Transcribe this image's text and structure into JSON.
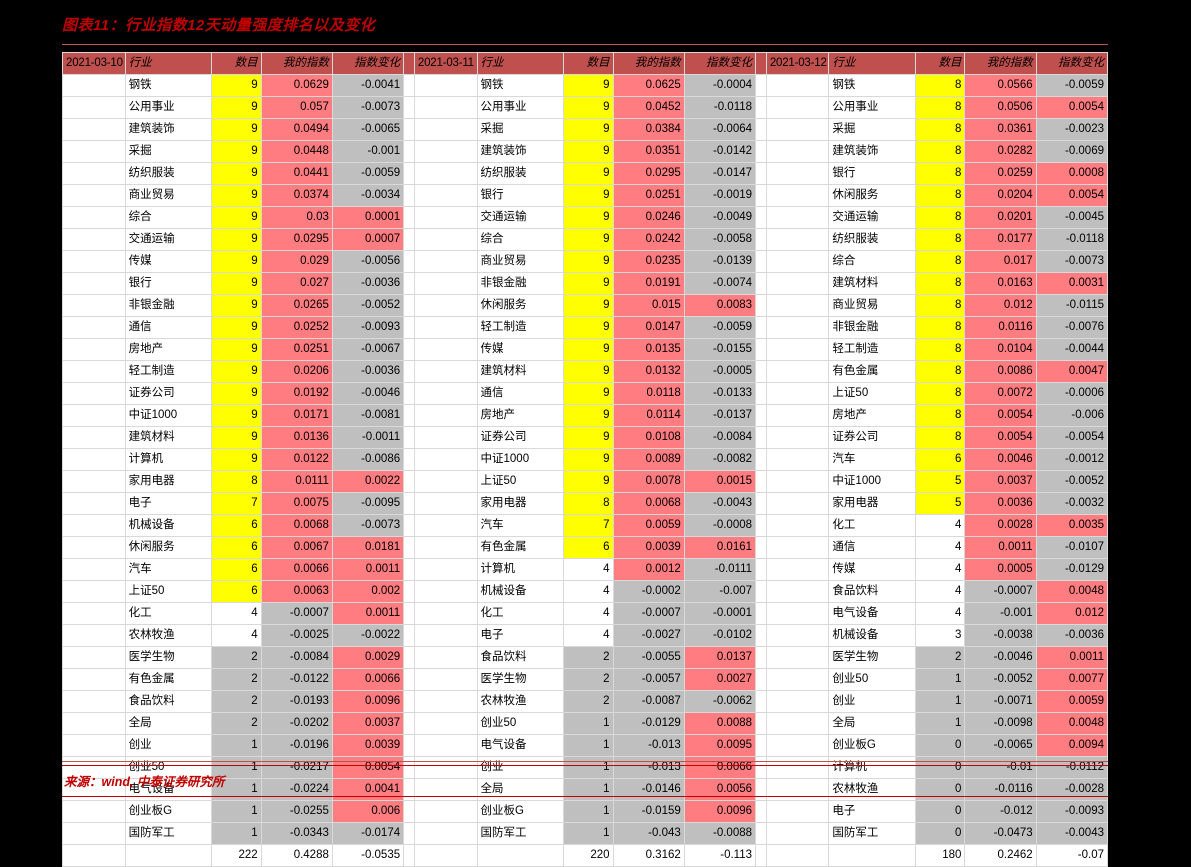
{
  "title": "图表11：行业指数12天动量强度排名以及变化",
  "source": "来源：wind, 中泰证券研究所",
  "columns": {
    "industry": "行业",
    "count": "数目",
    "index": "我的指数",
    "change": "指数变化"
  },
  "chart_data": {
    "type": "table",
    "title": "图表11：行业指数12天动量强度排名以及变化",
    "column_headers": [
      "行业",
      "数目",
      "我的指数",
      "指数变化"
    ],
    "panels": [
      {
        "date": "2021-03-10",
        "rows": [
          {
            "industry": "钢铁",
            "count": 9,
            "index": "0.0629",
            "change": "-0.0041"
          },
          {
            "industry": "公用事业",
            "count": 9,
            "index": "0.057",
            "change": "-0.0073"
          },
          {
            "industry": "建筑装饰",
            "count": 9,
            "index": "0.0494",
            "change": "-0.0065"
          },
          {
            "industry": "采掘",
            "count": 9,
            "index": "0.0448",
            "change": "-0.001"
          },
          {
            "industry": "纺织服装",
            "count": 9,
            "index": "0.0441",
            "change": "-0.0059"
          },
          {
            "industry": "商业贸易",
            "count": 9,
            "index": "0.0374",
            "change": "-0.0034"
          },
          {
            "industry": "综合",
            "count": 9,
            "index": "0.03",
            "change": "0.0001"
          },
          {
            "industry": "交通运输",
            "count": 9,
            "index": "0.0295",
            "change": "0.0007"
          },
          {
            "industry": "传媒",
            "count": 9,
            "index": "0.029",
            "change": "-0.0056"
          },
          {
            "industry": "银行",
            "count": 9,
            "index": "0.027",
            "change": "-0.0036"
          },
          {
            "industry": "非银金融",
            "count": 9,
            "index": "0.0265",
            "change": "-0.0052"
          },
          {
            "industry": "通信",
            "count": 9,
            "index": "0.0252",
            "change": "-0.0093"
          },
          {
            "industry": "房地产",
            "count": 9,
            "index": "0.0251",
            "change": "-0.0067"
          },
          {
            "industry": "轻工制造",
            "count": 9,
            "index": "0.0206",
            "change": "-0.0036"
          },
          {
            "industry": "证券公司",
            "count": 9,
            "index": "0.0192",
            "change": "-0.0046"
          },
          {
            "industry": "中证1000",
            "count": 9,
            "index": "0.0171",
            "change": "-0.0081"
          },
          {
            "industry": "建筑材料",
            "count": 9,
            "index": "0.0136",
            "change": "-0.0011"
          },
          {
            "industry": "计算机",
            "count": 9,
            "index": "0.0122",
            "change": "-0.0086"
          },
          {
            "industry": "家用电器",
            "count": 8,
            "index": "0.0111",
            "change": "0.0022"
          },
          {
            "industry": "电子",
            "count": 7,
            "index": "0.0075",
            "change": "-0.0095"
          },
          {
            "industry": "机械设备",
            "count": 6,
            "index": "0.0068",
            "change": "-0.0073"
          },
          {
            "industry": "休闲服务",
            "count": 6,
            "index": "0.0067",
            "change": "0.0181"
          },
          {
            "industry": "汽车",
            "count": 6,
            "index": "0.0066",
            "change": "0.0011"
          },
          {
            "industry": "上证50",
            "count": 6,
            "index": "0.0063",
            "change": "0.002"
          },
          {
            "industry": "化工",
            "count": 4,
            "index": "-0.0007",
            "change": "0.0011"
          },
          {
            "industry": "农林牧渔",
            "count": 4,
            "index": "-0.0025",
            "change": "-0.0022"
          },
          {
            "industry": "医学生物",
            "count": 2,
            "index": "-0.0084",
            "change": "0.0029"
          },
          {
            "industry": "有色金属",
            "count": 2,
            "index": "-0.0122",
            "change": "0.0066"
          },
          {
            "industry": "食品饮料",
            "count": 2,
            "index": "-0.0193",
            "change": "0.0096"
          },
          {
            "industry": "全局",
            "count": 2,
            "index": "-0.0202",
            "change": "0.0037"
          },
          {
            "industry": "创业",
            "count": 1,
            "index": "-0.0196",
            "change": "0.0039"
          },
          {
            "industry": "创业50",
            "count": 1,
            "index": "-0.0217",
            "change": "0.0054"
          },
          {
            "industry": "电气设备",
            "count": 1,
            "index": "-0.0224",
            "change": "0.0041"
          },
          {
            "industry": "创业板G",
            "count": 1,
            "index": "-0.0255",
            "change": "0.006"
          },
          {
            "industry": "国防军工",
            "count": 1,
            "index": "-0.0343",
            "change": "-0.0174"
          }
        ],
        "total": {
          "count": "222",
          "index": "0.4288",
          "change": "-0.0535"
        }
      },
      {
        "date": "2021-03-11",
        "rows": [
          {
            "industry": "钢铁",
            "count": 9,
            "index": "0.0625",
            "change": "-0.0004"
          },
          {
            "industry": "公用事业",
            "count": 9,
            "index": "0.0452",
            "change": "-0.0118"
          },
          {
            "industry": "采掘",
            "count": 9,
            "index": "0.0384",
            "change": "-0.0064"
          },
          {
            "industry": "建筑装饰",
            "count": 9,
            "index": "0.0351",
            "change": "-0.0142"
          },
          {
            "industry": "纺织服装",
            "count": 9,
            "index": "0.0295",
            "change": "-0.0147"
          },
          {
            "industry": "银行",
            "count": 9,
            "index": "0.0251",
            "change": "-0.0019"
          },
          {
            "industry": "交通运输",
            "count": 9,
            "index": "0.0246",
            "change": "-0.0049"
          },
          {
            "industry": "综合",
            "count": 9,
            "index": "0.0242",
            "change": "-0.0058"
          },
          {
            "industry": "商业贸易",
            "count": 9,
            "index": "0.0235",
            "change": "-0.0139"
          },
          {
            "industry": "非银金融",
            "count": 9,
            "index": "0.0191",
            "change": "-0.0074"
          },
          {
            "industry": "休闲服务",
            "count": 9,
            "index": "0.015",
            "change": "0.0083"
          },
          {
            "industry": "轻工制造",
            "count": 9,
            "index": "0.0147",
            "change": "-0.0059"
          },
          {
            "industry": "传媒",
            "count": 9,
            "index": "0.0135",
            "change": "-0.0155"
          },
          {
            "industry": "建筑材料",
            "count": 9,
            "index": "0.0132",
            "change": "-0.0005"
          },
          {
            "industry": "通信",
            "count": 9,
            "index": "0.0118",
            "change": "-0.0133"
          },
          {
            "industry": "房地产",
            "count": 9,
            "index": "0.0114",
            "change": "-0.0137"
          },
          {
            "industry": "证券公司",
            "count": 9,
            "index": "0.0108",
            "change": "-0.0084"
          },
          {
            "industry": "中证1000",
            "count": 9,
            "index": "0.0089",
            "change": "-0.0082"
          },
          {
            "industry": "上证50",
            "count": 9,
            "index": "0.0078",
            "change": "0.0015"
          },
          {
            "industry": "家用电器",
            "count": 8,
            "index": "0.0068",
            "change": "-0.0043"
          },
          {
            "industry": "汽车",
            "count": 7,
            "index": "0.0059",
            "change": "-0.0008"
          },
          {
            "industry": "有色金属",
            "count": 6,
            "index": "0.0039",
            "change": "0.0161"
          },
          {
            "industry": "计算机",
            "count": 4,
            "index": "0.0012",
            "change": "-0.0111"
          },
          {
            "industry": "机械设备",
            "count": 4,
            "index": "-0.0002",
            "change": "-0.007"
          },
          {
            "industry": "化工",
            "count": 4,
            "index": "-0.0007",
            "change": "-0.0001"
          },
          {
            "industry": "电子",
            "count": 4,
            "index": "-0.0027",
            "change": "-0.0102"
          },
          {
            "industry": "食品饮料",
            "count": 2,
            "index": "-0.0055",
            "change": "0.0137"
          },
          {
            "industry": "医学生物",
            "count": 2,
            "index": "-0.0057",
            "change": "0.0027"
          },
          {
            "industry": "农林牧渔",
            "count": 2,
            "index": "-0.0087",
            "change": "-0.0062"
          },
          {
            "industry": "创业50",
            "count": 1,
            "index": "-0.0129",
            "change": "0.0088"
          },
          {
            "industry": "电气设备",
            "count": 1,
            "index": "-0.013",
            "change": "0.0095"
          },
          {
            "industry": "创业",
            "count": 1,
            "index": "-0.013",
            "change": "0.0066"
          },
          {
            "industry": "全局",
            "count": 1,
            "index": "-0.0146",
            "change": "0.0056"
          },
          {
            "industry": "创业板G",
            "count": 1,
            "index": "-0.0159",
            "change": "0.0096"
          },
          {
            "industry": "国防军工",
            "count": 1,
            "index": "-0.043",
            "change": "-0.0088"
          }
        ],
        "total": {
          "count": "220",
          "index": "0.3162",
          "change": "-0.113"
        }
      },
      {
        "date": "2021-03-12",
        "rows": [
          {
            "industry": "钢铁",
            "count": 8,
            "index": "0.0566",
            "change": "-0.0059"
          },
          {
            "industry": "公用事业",
            "count": 8,
            "index": "0.0506",
            "change": "0.0054"
          },
          {
            "industry": "采掘",
            "count": 8,
            "index": "0.0361",
            "change": "-0.0023"
          },
          {
            "industry": "建筑装饰",
            "count": 8,
            "index": "0.0282",
            "change": "-0.0069"
          },
          {
            "industry": "银行",
            "count": 8,
            "index": "0.0259",
            "change": "0.0008"
          },
          {
            "industry": "休闲服务",
            "count": 8,
            "index": "0.0204",
            "change": "0.0054"
          },
          {
            "industry": "交通运输",
            "count": 8,
            "index": "0.0201",
            "change": "-0.0045"
          },
          {
            "industry": "纺织服装",
            "count": 8,
            "index": "0.0177",
            "change": "-0.0118"
          },
          {
            "industry": "综合",
            "count": 8,
            "index": "0.017",
            "change": "-0.0073"
          },
          {
            "industry": "建筑材料",
            "count": 8,
            "index": "0.0163",
            "change": "0.0031"
          },
          {
            "industry": "商业贸易",
            "count": 8,
            "index": "0.012",
            "change": "-0.0115"
          },
          {
            "industry": "非银金融",
            "count": 8,
            "index": "0.0116",
            "change": "-0.0076"
          },
          {
            "industry": "轻工制造",
            "count": 8,
            "index": "0.0104",
            "change": "-0.0044"
          },
          {
            "industry": "有色金属",
            "count": 8,
            "index": "0.0086",
            "change": "0.0047"
          },
          {
            "industry": "上证50",
            "count": 8,
            "index": "0.0072",
            "change": "-0.0006"
          },
          {
            "industry": "房地产",
            "count": 8,
            "index": "0.0054",
            "change": "-0.006"
          },
          {
            "industry": "证券公司",
            "count": 8,
            "index": "0.0054",
            "change": "-0.0054"
          },
          {
            "industry": "汽车",
            "count": 6,
            "index": "0.0046",
            "change": "-0.0012"
          },
          {
            "industry": "中证1000",
            "count": 5,
            "index": "0.0037",
            "change": "-0.0052"
          },
          {
            "industry": "家用电器",
            "count": 5,
            "index": "0.0036",
            "change": "-0.0032"
          },
          {
            "industry": "化工",
            "count": 4,
            "index": "0.0028",
            "change": "0.0035"
          },
          {
            "industry": "通信",
            "count": 4,
            "index": "0.0011",
            "change": "-0.0107"
          },
          {
            "industry": "传媒",
            "count": 4,
            "index": "0.0005",
            "change": "-0.0129"
          },
          {
            "industry": "食品饮料",
            "count": 4,
            "index": "-0.0007",
            "change": "0.0048"
          },
          {
            "industry": "电气设备",
            "count": 4,
            "index": "-0.001",
            "change": "0.012"
          },
          {
            "industry": "机械设备",
            "count": 3,
            "index": "-0.0038",
            "change": "-0.0036"
          },
          {
            "industry": "医学生物",
            "count": 2,
            "index": "-0.0046",
            "change": "0.0011"
          },
          {
            "industry": "创业50",
            "count": 1,
            "index": "-0.0052",
            "change": "0.0077"
          },
          {
            "industry": "创业",
            "count": 1,
            "index": "-0.0071",
            "change": "0.0059"
          },
          {
            "industry": "全局",
            "count": 1,
            "index": "-0.0098",
            "change": "0.0048"
          },
          {
            "industry": "创业板G",
            "count": 0,
            "index": "-0.0065",
            "change": "0.0094"
          },
          {
            "industry": "计算机",
            "count": 0,
            "index": "-0.01",
            "change": "-0.0112"
          },
          {
            "industry": "农林牧渔",
            "count": 0,
            "index": "-0.0116",
            "change": "-0.0028"
          },
          {
            "industry": "电子",
            "count": 0,
            "index": "-0.012",
            "change": "-0.0093"
          },
          {
            "industry": "国防军工",
            "count": 0,
            "index": "-0.0473",
            "change": "-0.0043"
          }
        ],
        "total": {
          "count": "180",
          "index": "0.2462",
          "change": "-0.07"
        }
      }
    ]
  },
  "colors": {
    "header_bg": "#C0504D",
    "accent_red": "#C00000",
    "highlight_yellow": "#FFFF00",
    "highlight_pink": "#FF7C80",
    "highlight_gray": "#BFBFBF"
  }
}
